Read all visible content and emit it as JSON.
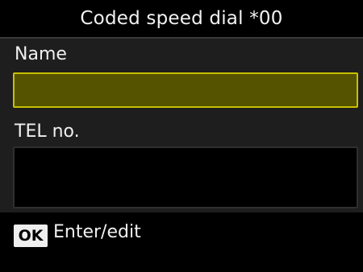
{
  "header": {
    "title": "Coded speed dial *00"
  },
  "form": {
    "name_label": "Name",
    "name_value": "",
    "tel_label": "TEL no.",
    "tel_value": ""
  },
  "footer": {
    "ok_key": "OK",
    "hint": "Enter/edit"
  },
  "colors": {
    "selected_field_fill": "#555200",
    "selected_field_border": "#c8c000"
  }
}
